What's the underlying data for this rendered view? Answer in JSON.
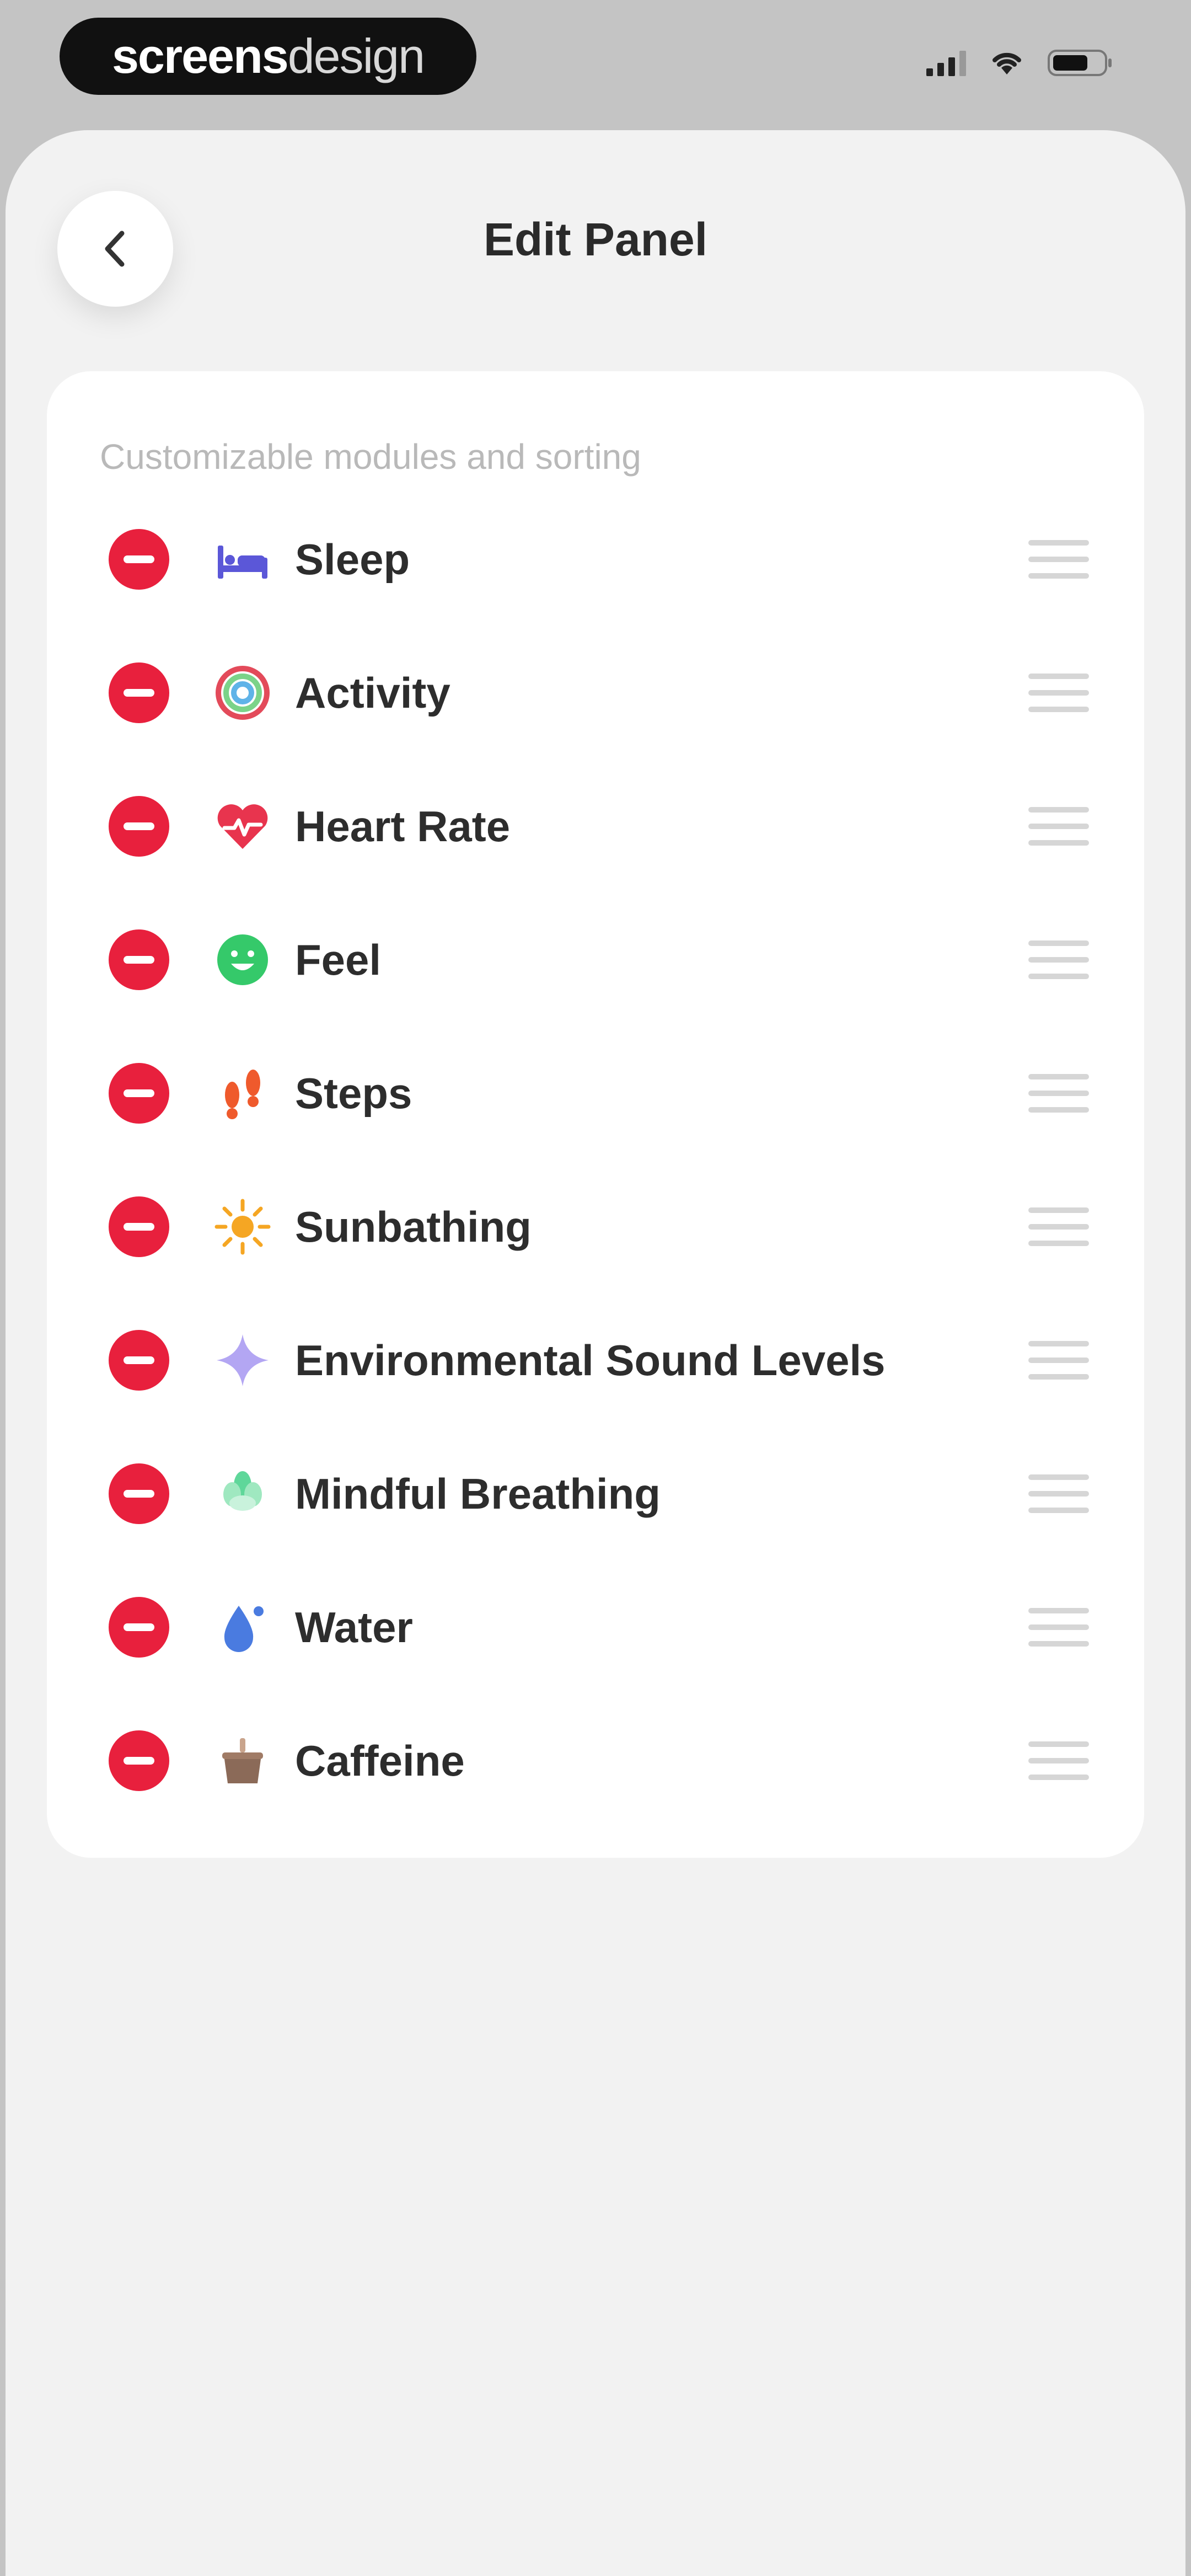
{
  "status_bar": {
    "brand_bold": "screens",
    "brand_light": "design"
  },
  "header": {
    "title": "Edit Panel"
  },
  "card": {
    "subtitle": "Customizable modules and sorting"
  },
  "modules": [
    {
      "label": "Sleep",
      "icon": "bed-icon",
      "color": "#5b57d8"
    },
    {
      "label": "Activity",
      "icon": "activity-ring-icon",
      "color": "#e34a5a"
    },
    {
      "label": "Heart Rate",
      "icon": "heart-pulse-icon",
      "color": "#e8344e"
    },
    {
      "label": "Feel",
      "icon": "smiley-icon",
      "color": "#35c96a"
    },
    {
      "label": "Steps",
      "icon": "footprints-icon",
      "color": "#ef5a2c"
    },
    {
      "label": "Sunbathing",
      "icon": "sun-icon",
      "color": "#f5a623"
    },
    {
      "label": "Environmental Sound Levels",
      "icon": "sound-sparkle-icon",
      "color": "#a99cf0"
    },
    {
      "label": "Mindful Breathing",
      "icon": "breathing-icon",
      "color": "#4fd08f"
    },
    {
      "label": "Water",
      "icon": "water-drop-icon",
      "color": "#4a7be0"
    },
    {
      "label": "Caffeine",
      "icon": "coffee-cup-icon",
      "color": "#8b6a58"
    }
  ],
  "colors": {
    "remove": "#e8203d",
    "background": "#f2f2f2",
    "card": "#ffffff"
  }
}
